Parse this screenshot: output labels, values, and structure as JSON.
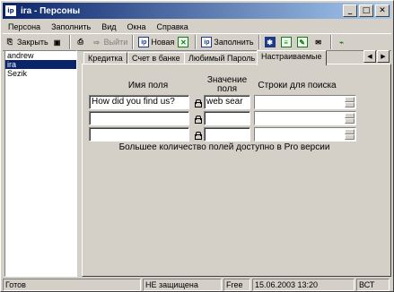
{
  "window": {
    "title": "ira - Персоны",
    "app_icon": "ip"
  },
  "menu": [
    "Персона",
    "Заполнить",
    "Вид",
    "Окна",
    "Справка"
  ],
  "toolbar": {
    "close_label": "Закрыть",
    "exit_label": "Выйти",
    "new_label": "Новая",
    "fill_label": "Заполнить"
  },
  "persons": [
    "andrew",
    "ira",
    "Sezik"
  ],
  "tabs": [
    "Кредитка",
    "Счет в банке",
    "Любимый Пароль",
    "Настраиваемые"
  ],
  "headers": {
    "field_name": "Имя поля",
    "value": "Значение поля",
    "search": "Строки для поиска"
  },
  "fields": [
    {
      "name": "How did you find us?",
      "value": "web sear",
      "search": ""
    },
    {
      "name": "",
      "value": "",
      "search": ""
    },
    {
      "name": "",
      "value": "",
      "search": ""
    }
  ],
  "note": "Большее количество полей доступно в Pro версии",
  "status": {
    "state": "Готов",
    "protection": "НЕ защищена",
    "license": "Free",
    "datetime": "15.06.2003 13:20",
    "day": "ВСТ"
  }
}
